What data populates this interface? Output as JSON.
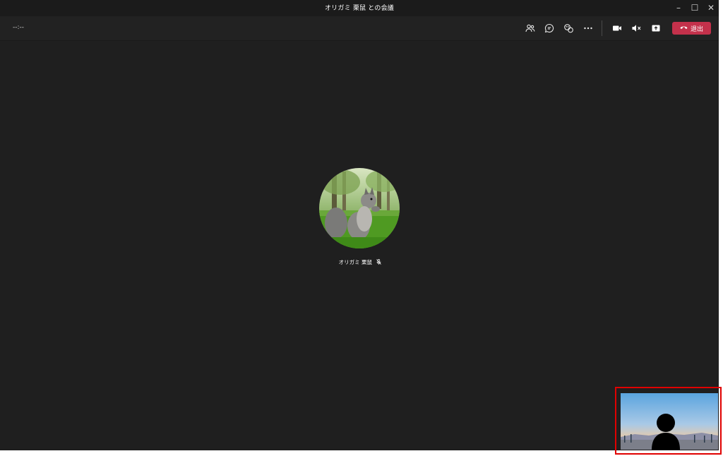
{
  "window": {
    "title": "オリガミ 栗鼠 との会議"
  },
  "window_controls": {
    "minimize": "–",
    "maximize": "☐",
    "close": "✕"
  },
  "toolbar": {
    "timer": "--:--",
    "leave_label": "退出"
  },
  "icons": {
    "participants": "people-icon",
    "chat": "chat-icon",
    "reactions": "reactions-icon",
    "more": "more-options-icon",
    "camera": "camera-icon",
    "mic": "mic-muted-icon",
    "share": "share-screen-icon",
    "leave": "hang-up-icon"
  },
  "stage": {
    "participant_name": "オリガミ 栗鼠",
    "participant_avatar": "squirrel-photo"
  },
  "colors": {
    "background": "#1f1f1f",
    "leave_button": "#c4314b",
    "selfview_highlight": "#e00000"
  }
}
